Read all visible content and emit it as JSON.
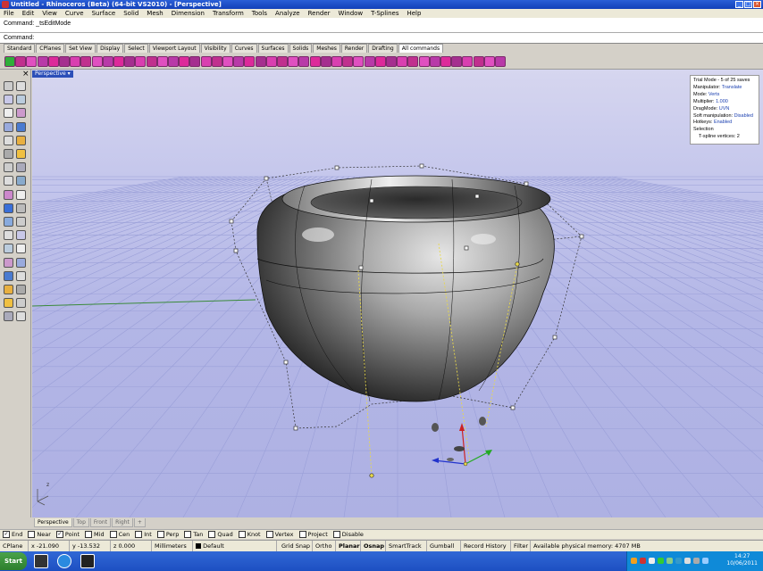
{
  "window": {
    "title": "Untitled - Rhinoceros (Beta) (64-bit VS2010) - [Perspective]"
  },
  "menu": [
    "File",
    "Edit",
    "View",
    "Curve",
    "Surface",
    "Solid",
    "Mesh",
    "Dimension",
    "Transform",
    "Tools",
    "Analyze",
    "Render",
    "Window",
    "T-Splines",
    "Help"
  ],
  "command": {
    "history_line": "Command: _tsEditMode",
    "prompt_line": "Command:"
  },
  "toolbar_tabs": [
    "Standard",
    "CPlanes",
    "Set View",
    "Display",
    "Select",
    "Viewport Layout",
    "Visibility",
    "Curves",
    "Surfaces",
    "Solids",
    "Meshes",
    "Render",
    "Drafting",
    "All commands"
  ],
  "toolbar_tabs_active": "All commands",
  "viewport": {
    "label": "Perspective",
    "info": {
      "trial": "Trial Mode - 5 of 25 saves",
      "manipulator_label": "Manipulator:",
      "manipulator_value": "Translate",
      "mode_label": "Mode:",
      "mode_value": "Verts",
      "multiplier_label": "Multiplier:",
      "multiplier_value": "1.000",
      "dragmode_label": "DragMode:",
      "dragmode_value": "UVN",
      "soft_label": "Soft manipulation:",
      "soft_value": "Disabled",
      "hotkeys_label": "Hotkeys:",
      "hotkeys_value": "Enabled",
      "selection_label": "Selection",
      "vertices_label": "T-spline vertices:",
      "vertices_value": "2"
    },
    "axis_z": "z"
  },
  "viewport_tabs": [
    "Perspective",
    "Top",
    "Front",
    "Right",
    "+"
  ],
  "osnaps": [
    {
      "label": "End",
      "checked": true
    },
    {
      "label": "Near",
      "checked": false
    },
    {
      "label": "Point",
      "checked": true
    },
    {
      "label": "Mid",
      "checked": false
    },
    {
      "label": "Cen",
      "checked": false
    },
    {
      "label": "Int",
      "checked": false
    },
    {
      "label": "Perp",
      "checked": false
    },
    {
      "label": "Tan",
      "checked": false
    },
    {
      "label": "Quad",
      "checked": false
    },
    {
      "label": "Knot",
      "checked": false
    },
    {
      "label": "Vertex",
      "checked": false
    },
    {
      "label": "Project",
      "checked": false
    },
    {
      "label": "Disable",
      "checked": false
    }
  ],
  "status": {
    "cplane": "CPlane",
    "x": "x -21.090",
    "y": "y -13.532",
    "z": "z 0.000",
    "units": "Millimeters",
    "layer": "Default",
    "grid_snap": "Grid Snap",
    "ortho": "Ortho",
    "planar": "Planar",
    "osnap": "Osnap",
    "smarttrack": "SmartTrack",
    "gumball": "Gumball",
    "record_history": "Record History",
    "filter": "Filter",
    "memory": "Available physical memory: 4707 MB"
  },
  "taskbar": {
    "start": "Start",
    "time": "14:27",
    "date": "10/06/2011"
  },
  "colors": {
    "accent": "#2c4fb8",
    "viewport_bg": "#b3b6e6",
    "titlebar": "#1a4fcf"
  }
}
